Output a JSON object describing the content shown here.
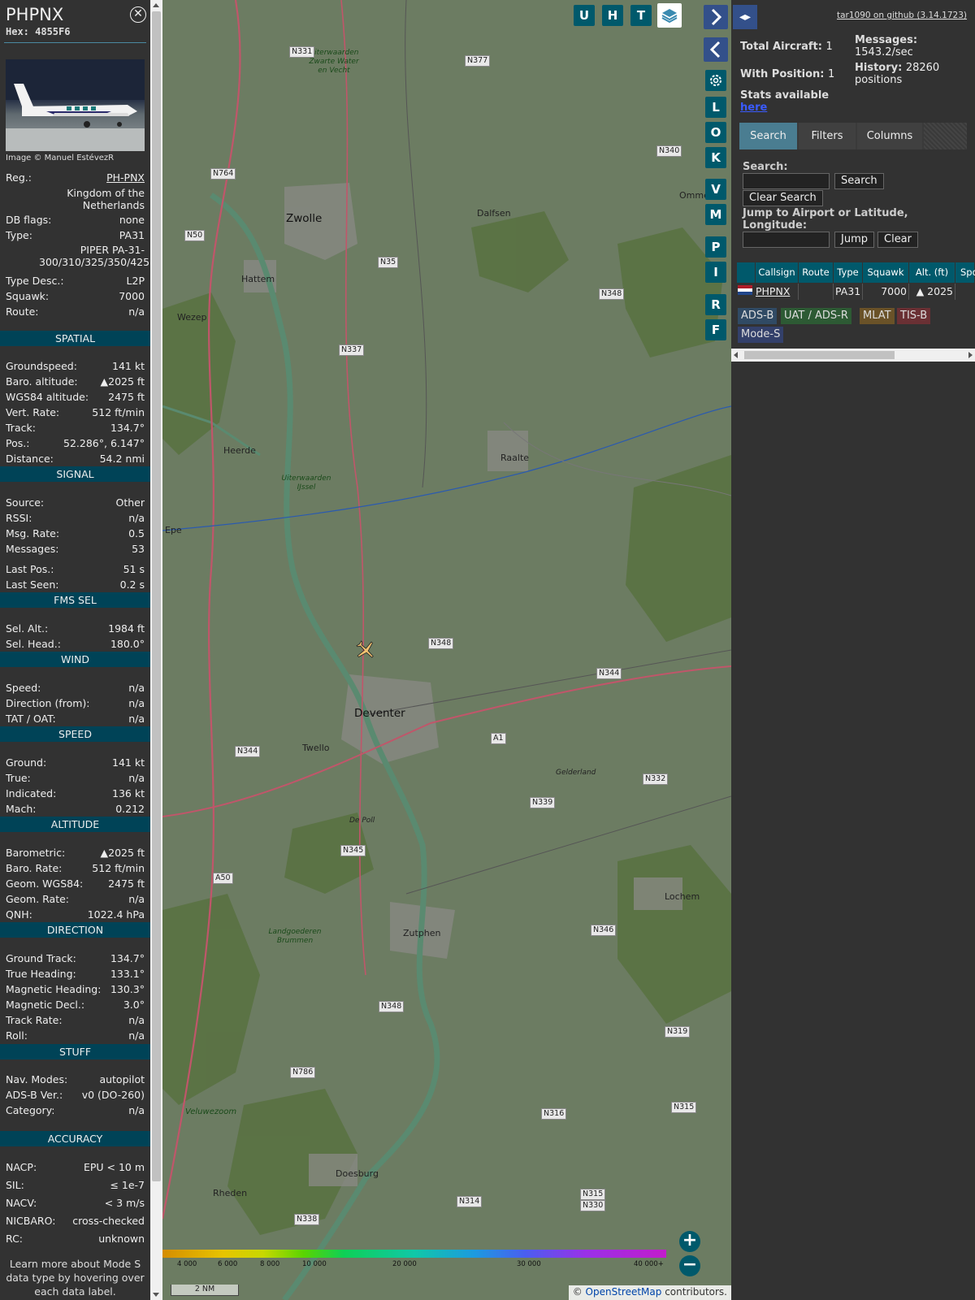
{
  "info": {
    "callsign": "PHPNX",
    "hex": "Hex: 4855F6",
    "photo_credit": "Image © Manuel EstévezR",
    "general": [
      {
        "k": "Reg.:",
        "v": "PH-PNX"
      },
      {
        "k": "",
        "v": "Kingdom of the Netherlands"
      },
      {
        "k": "DB flags:",
        "v": "none"
      },
      {
        "k": "Type:",
        "v": "PA31"
      },
      {
        "k": "",
        "v": "PIPER PA-31-300/310/325/350/425"
      },
      {
        "k": "Type Desc.:",
        "v": "L2P"
      },
      {
        "k": "Squawk:",
        "v": "7000"
      },
      {
        "k": "Route:",
        "v": "n/a"
      }
    ],
    "spatial_title": "SPATIAL",
    "spatial": [
      {
        "k": "Groundspeed:",
        "v": "141 kt"
      },
      {
        "k": "Baro. altitude:",
        "v": "▲2025 ft"
      },
      {
        "k": "WGS84 altitude:",
        "v": "2475 ft"
      },
      {
        "k": "Vert. Rate:",
        "v": "512 ft/min"
      },
      {
        "k": "Track:",
        "v": "134.7°"
      },
      {
        "k": "Pos.:",
        "v": "52.286°, 6.147°"
      },
      {
        "k": "Distance:",
        "v": "54.2 nmi"
      }
    ],
    "signal_title": "SIGNAL",
    "signal": [
      {
        "k": "Source:",
        "v": "Other"
      },
      {
        "k": "RSSI:",
        "v": "n/a"
      },
      {
        "k": "Msg. Rate:",
        "v": "0.5"
      },
      {
        "k": "Messages:",
        "v": "53"
      },
      {
        "k": "Last Pos.:",
        "v": "51 s"
      },
      {
        "k": "Last Seen:",
        "v": "0.2 s"
      }
    ],
    "fms_title": "FMS SEL",
    "fms": [
      {
        "k": "Sel. Alt.:",
        "v": "1984 ft"
      },
      {
        "k": "Sel. Head.:",
        "v": "180.0°"
      }
    ],
    "wind_title": "WIND",
    "wind": [
      {
        "k": "Speed:",
        "v": "n/a"
      },
      {
        "k": "Direction (from):",
        "v": "n/a"
      },
      {
        "k": "TAT / OAT:",
        "v": "n/a"
      }
    ],
    "speed_title": "SPEED",
    "speed": [
      {
        "k": "Ground:",
        "v": "141 kt"
      },
      {
        "k": "True:",
        "v": "n/a"
      },
      {
        "k": "Indicated:",
        "v": "136 kt"
      },
      {
        "k": "Mach:",
        "v": "0.212"
      }
    ],
    "altitude_title": "ALTITUDE",
    "altitude": [
      {
        "k": "Barometric:",
        "v": "▲2025 ft"
      },
      {
        "k": "Baro. Rate:",
        "v": "512 ft/min"
      },
      {
        "k": "Geom. WGS84:",
        "v": "2475 ft"
      },
      {
        "k": "Geom. Rate:",
        "v": "n/a"
      },
      {
        "k": "QNH:",
        "v": "1022.4 hPa"
      }
    ],
    "direction_title": "DIRECTION",
    "direction": [
      {
        "k": "Ground Track:",
        "v": "134.7°"
      },
      {
        "k": "True Heading:",
        "v": "133.1°"
      },
      {
        "k": "Magnetic Heading:",
        "v": "130.3°"
      },
      {
        "k": "Magnetic Decl.:",
        "v": "3.0°"
      },
      {
        "k": "Track Rate:",
        "v": "n/a"
      },
      {
        "k": "Roll:",
        "v": "n/a"
      }
    ],
    "stuff_title": "STUFF",
    "stuff": [
      {
        "k": "Nav. Modes:",
        "v": "autopilot"
      },
      {
        "k": "ADS-B Ver.:",
        "v": "v0 (DO-260)"
      },
      {
        "k": "Category:",
        "v": "n/a"
      }
    ],
    "accuracy_title": "ACCURACY",
    "accuracy": [
      {
        "k": "NACP:",
        "v": "EPU < 10 m"
      },
      {
        "k": "SIL:",
        "v": "≤ 1e-7"
      },
      {
        "k": "NACV:",
        "v": "< 3 m/s"
      },
      {
        "k": "NICBARO:",
        "v": "cross-checked"
      },
      {
        "k": "RC:",
        "v": "unknown"
      }
    ],
    "learn_more": "Learn more about Mode S data type by hovering over each data label."
  },
  "map": {
    "top_buttons": [
      "U",
      "H",
      "T"
    ],
    "side_buttons": [
      "L",
      "O",
      "K",
      "V",
      "M",
      "P",
      "I",
      "R",
      "F"
    ],
    "towns": [
      {
        "name": "Zwolle",
        "big": true
      },
      {
        "name": "Deventer",
        "big": true
      },
      {
        "name": "Dalfsen"
      },
      {
        "name": "Hattem"
      },
      {
        "name": "Wezep"
      },
      {
        "name": "Heerde"
      },
      {
        "name": "Raalte"
      },
      {
        "name": "Twello"
      },
      {
        "name": "Zutphen"
      },
      {
        "name": "Lochem"
      },
      {
        "name": "Doesburg"
      },
      {
        "name": "Rheden"
      },
      {
        "name": "Ommen"
      },
      {
        "name": "Epe"
      },
      {
        "name": "De Poll"
      },
      {
        "name": "Gelderland"
      },
      {
        "name": "Veluwezoom"
      },
      {
        "name": "Uiterwaarden Zwarte Water en Vecht"
      },
      {
        "name": "Uiterwaarden IJssel"
      },
      {
        "name": "Landgoederen Brummen"
      }
    ],
    "roads": [
      "N331",
      "N377",
      "N340",
      "N764",
      "N50",
      "N35",
      "N348",
      "N337",
      "N348",
      "N344",
      "N344",
      "N332",
      "A1",
      "N339",
      "N345",
      "A50",
      "N346",
      "N348",
      "N319",
      "N786",
      "N316",
      "N315",
      "N314",
      "N315",
      "N330",
      "N338"
    ],
    "alt_labels": [
      "4 000",
      "6 000",
      "8 000",
      "10 000",
      "20 000",
      "30 000",
      "40 000+"
    ],
    "scale": "2 NM",
    "attribution_prefix": "© ",
    "attribution_link": "OpenStreetMap",
    "attribution_suffix": " contributors.",
    "toggle_label": "◂▸"
  },
  "sidebar": {
    "version": "tar1090 on github (3.14.1723)",
    "total_aircraft_label": "Total Aircraft:",
    "total_aircraft": "1",
    "with_position_label": "With Position:",
    "with_position": "1",
    "messages_label": "Messages:",
    "messages": "1543.2/sec",
    "history_label": "History:",
    "history": "28260 positions",
    "stats_label": "Stats available",
    "stats_link": "here",
    "tabs": [
      "Search",
      "Filters",
      "Columns"
    ],
    "search_label": "Search:",
    "search_button": "Search",
    "clear_search_button": "Clear Search",
    "jump_label": "Jump to Airport or Latitude, Longitude:",
    "jump_button": "Jump",
    "clear_button": "Clear",
    "columns": [
      "Callsign",
      "Route",
      "Type",
      "Squawk",
      "Alt. (ft)",
      "Spd"
    ],
    "row": {
      "callsign": "PHPNX",
      "route": "",
      "type": "PA31",
      "squawk": "7000",
      "alt": "▲ 2025"
    },
    "sources": [
      {
        "label": "ADS-B",
        "color": "#304a64"
      },
      {
        "label": "UAT / ADS-R",
        "color": "#2d5a34"
      },
      {
        "label": "MLAT",
        "color": "#6a5228"
      },
      {
        "label": "TIS-B",
        "color": "#6a3034"
      },
      {
        "label": "Mode-S",
        "color": "#33406a"
      }
    ]
  }
}
